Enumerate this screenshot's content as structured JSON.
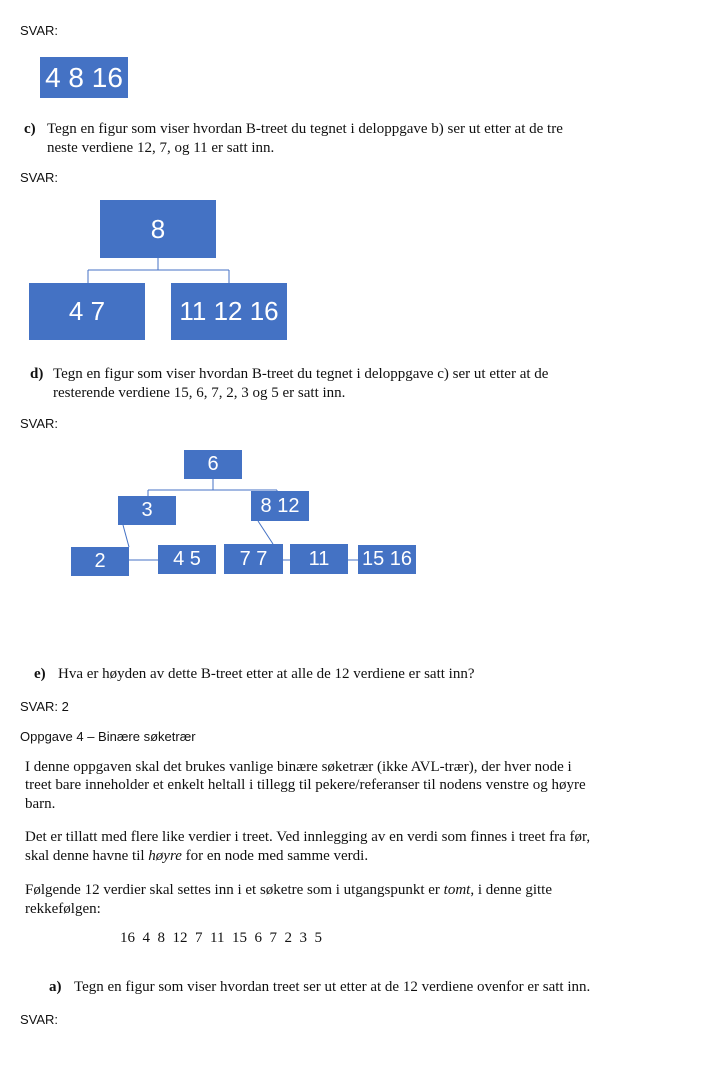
{
  "svar_label": "SVAR:",
  "b_answer": {
    "node": "4 8 16"
  },
  "c": {
    "label": "c)",
    "line1": "Tegn en figur som viser hvordan B-treet du tegnet i deloppgave b) ser ut etter at de tre",
    "line2": "neste verdiene 12, 7, og 11 er satt inn.",
    "tree": {
      "root": "8",
      "left": "4 7",
      "right": "11 12 16"
    }
  },
  "d": {
    "label": "d)",
    "line1": "Tegn en figur som viser hvordan B-treet du tegnet i deloppgave c) ser ut etter at de",
    "line2": "resterende verdiene 15, 6, 7, 2, 3  og 5 er satt inn.",
    "tree": {
      "root": "6",
      "mid_left": "3",
      "mid_right": "8 12",
      "leaf1": "2",
      "leaf2": "4 5",
      "leaf3": "7 7",
      "leaf4": "11",
      "leaf5": "15 16"
    }
  },
  "e": {
    "label": "e)",
    "question": "Hva er høyden av dette B-treet etter at alle de 12 verdiene er satt inn?",
    "answer": "SVAR: 2"
  },
  "oppgave4": {
    "heading": "Oppgave 4 – Binære søketrær",
    "p1_l1": "I denne oppgaven skal det brukes vanlige binære søketrær (ikke AVL-trær), der hver node i",
    "p1_l2": "treet bare inneholder et enkelt heltall i tillegg til pekere/referanser til nodens venstre og høyre",
    "p1_l3": "barn.",
    "p2_l1": "Det er tillatt med flere like verdier i treet. Ved innlegging av en verdi som finnes i treet fra før,",
    "p2_l2_pre": "skal denne havne til ",
    "p2_l2_em": "høyre",
    "p2_l2_post": " for en node med samme verdi.",
    "p3_l1_pre": "Følgende 12 verdier skal settes inn i et søketre som i utgangspunkt er ",
    "p3_l1_em": "tomt",
    "p3_l1_post": ", i denne gitte",
    "p3_l2": "rekkefølgen:",
    "sequence": "16  4  8  12  7  11  15  6  7  2  3  5",
    "a_label": "a)",
    "a_text": "Tegn en figur som viser hvordan treet ser ut etter at de 12 verdiene ovenfor er satt inn."
  }
}
